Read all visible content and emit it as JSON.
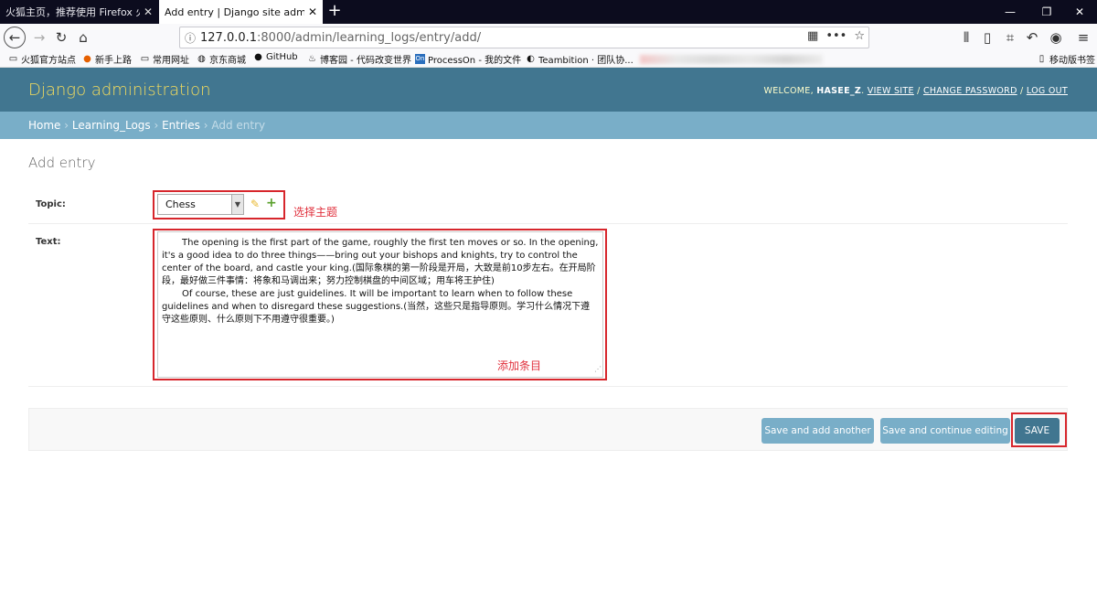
{
  "browser": {
    "tabs": [
      {
        "title": "火狐主页，推荐使用 Firefox 火狐浏",
        "active": false
      },
      {
        "title": "Add entry | Django site admin",
        "active": true
      }
    ],
    "new_tab": "+",
    "window_controls": {
      "minimize": "—",
      "restore": "❐",
      "close": "✕"
    },
    "url": {
      "host": "127.0.0.1",
      "path": ":8000/admin/learning_logs/entry/add/"
    },
    "bookmarks": [
      "火狐官方站点",
      "新手上路",
      "常用网址",
      "京东商城",
      "GitHub",
      "博客园 - 代码改变世界",
      "ProcessOn - 我的文件",
      "Teambition · 团队协..."
    ],
    "mobile_bookmarks": "移动版书签"
  },
  "admin": {
    "branding": "Django administration",
    "user_tools": {
      "welcome": "WELCOME, ",
      "username": "HASEE_Z",
      "view_site": "VIEW SITE",
      "change_password": "CHANGE PASSWORD",
      "logout": "LOG OUT",
      "sep": " / "
    },
    "breadcrumbs": {
      "home": "Home",
      "app": "Learning_Logs",
      "model": "Entries",
      "current": "Add entry",
      "sep": " › "
    },
    "title": "Add entry",
    "form": {
      "topic_label": "Topic:",
      "topic_value": "Chess",
      "text_label": "Text:",
      "text_p1": "The opening is the first part of the game, roughly the first ten moves or so. In the opening, it's a good idea to do three things——bring out your bishops and knights, try to control the center of the board, and castle your king.(国际象棋的第一阶段是开局，大致是前10步左右。在开局阶段，最好做三件事情：将象和马调出来；努力控制棋盘的中间区域；用车将王护住)",
      "text_p2": "Of course, these are just guidelines. It will be important to learn when to follow these guidelines and when to disregard these suggestions.(当然，这些只是指导原则。学习什么情况下遵守这些原则、什么原则下不用遵守很重要。)"
    },
    "annotations": {
      "topic": "选择主题",
      "text": "添加条目"
    },
    "buttons": {
      "save_add_another": "Save and add another",
      "save_continue": "Save and continue editing",
      "save": "SAVE"
    }
  },
  "colors": {
    "header": "#417690",
    "breadcrumbs": "#79aec8",
    "branding": "#f5dd5d",
    "annotation_red": "#d7262c"
  }
}
